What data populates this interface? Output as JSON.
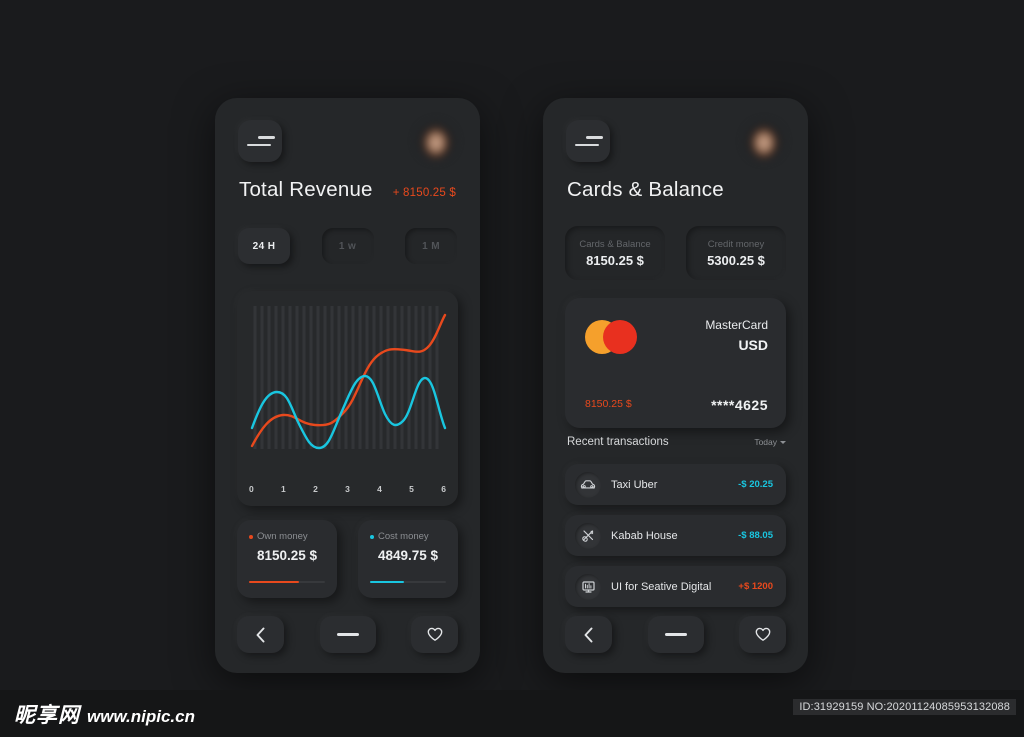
{
  "app": {
    "background_color": "#1a1b1d",
    "accent_orange": "#e8491d",
    "accent_cyan": "#19c6e0"
  },
  "left_phone": {
    "menu_icon": "hamburger-menu-icon",
    "avatar": "user-avatar",
    "title": "Total Revenue",
    "delta": "+ 8150.25 $",
    "ranges": [
      {
        "label": "24 H",
        "active": true
      },
      {
        "label": "1 w",
        "active": false
      },
      {
        "label": "1 M",
        "active": false
      }
    ],
    "money_cards": [
      {
        "label": "Own money",
        "value": "8150.25 $",
        "color": "#e8491d",
        "progress": 66
      },
      {
        "label": "Cost money",
        "value": "4849.75 $",
        "color": "#19c6e0",
        "progress": 45
      }
    ],
    "nav": {
      "back_icon": "chevron-left-icon",
      "home_icon": "dash-icon",
      "favorite_icon": "heart-icon"
    }
  },
  "chart_data": {
    "type": "line",
    "title": "Total Revenue",
    "xlabel": "",
    "ylabel": "",
    "grid": true,
    "grid_orientation": "vertical",
    "legend_position": "below-as-cards",
    "xlim": [
      0,
      6
    ],
    "ylim": [
      0,
      100
    ],
    "xtick_labels": [
      "0",
      "1",
      "2",
      "3",
      "4",
      "5",
      "6"
    ],
    "x": [
      0,
      0.5,
      1,
      1.5,
      2,
      2.5,
      3,
      3.5,
      4,
      4.5,
      5,
      5.5,
      6
    ],
    "series": [
      {
        "name": "Own money",
        "color": "#e8491d",
        "values": [
          4,
          22,
          27,
          24,
          23,
          26,
          45,
          72,
          80,
          81,
          80,
          83,
          97
        ]
      },
      {
        "name": "Cost money",
        "color": "#19c6e0",
        "values": [
          30,
          47,
          42,
          25,
          10,
          18,
          48,
          66,
          44,
          34,
          62,
          62,
          26
        ]
      }
    ]
  },
  "right_phone": {
    "menu_icon": "hamburger-menu-icon",
    "avatar": "user-avatar",
    "title": "Cards & Balance",
    "balances": [
      {
        "label": "Cards & Balance",
        "value": "8150.25 $"
      },
      {
        "label": "Credit money",
        "value": "5300.25 $"
      }
    ],
    "card": {
      "logo": "mastercard-logo",
      "brand": "MasterCard",
      "currency": "USD",
      "amount": "8150.25 $",
      "number": "****4625"
    },
    "transactions_header": {
      "title": "Recent transactions",
      "filter": "Today",
      "filter_icon": "chevron-down-icon"
    },
    "transactions": [
      {
        "icon": "car-icon",
        "name": "Taxi Uber",
        "amount": "-$ 20.25",
        "color": "#19c6e0"
      },
      {
        "icon": "cutlery-icon",
        "name": "Kabab House",
        "amount": "-$ 88.05",
        "color": "#19c6e0"
      },
      {
        "icon": "monitor-icon",
        "name": "UI  for Seative Digital",
        "amount": "+$ 1200",
        "color": "#e8491d"
      }
    ],
    "nav": {
      "back_icon": "chevron-left-icon",
      "home_icon": "dash-icon",
      "favorite_icon": "heart-icon"
    }
  },
  "footer": {
    "watermark_cn": "昵享网",
    "watermark_url": "www.nipic.cn",
    "id_tag": "ID:31929159 NO:20201124085953132088"
  }
}
